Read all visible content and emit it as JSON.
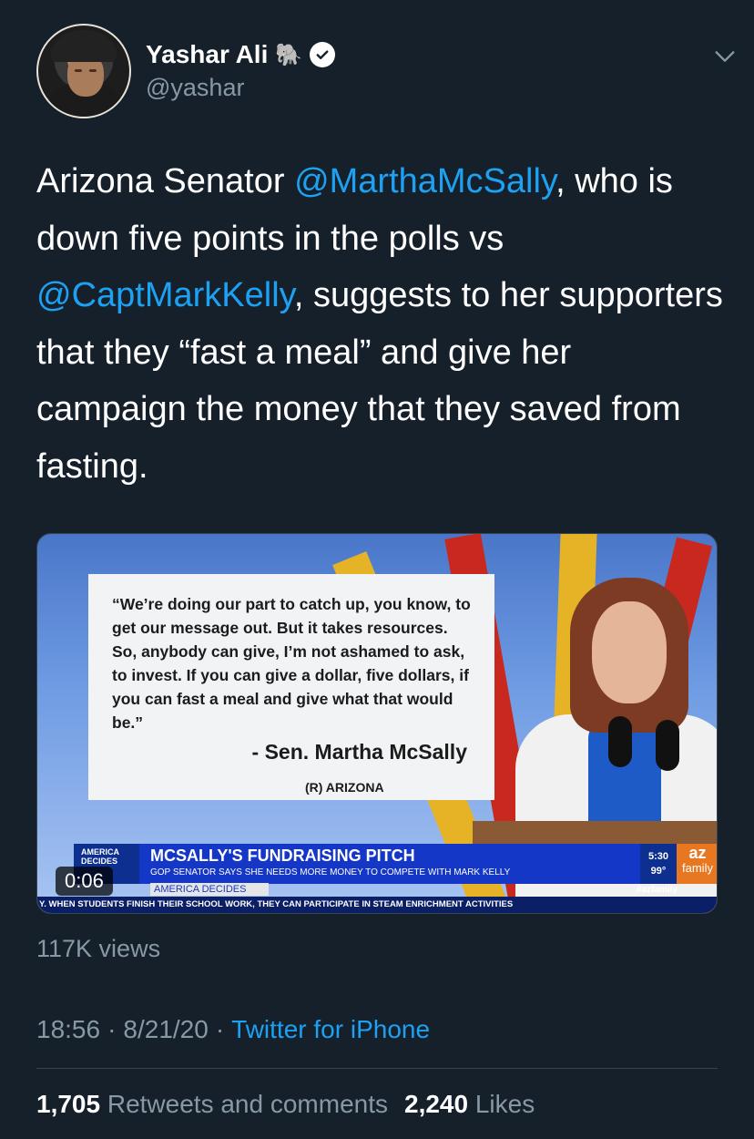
{
  "author": {
    "name": "Yashar Ali",
    "emoji": "🐘",
    "handle": "@yashar"
  },
  "tweet": {
    "part1": "Arizona Senator ",
    "mention1": "@MarthaMcSally",
    "part2": ", who is down five points in the polls vs ",
    "mention2": "@CaptMarkKelly",
    "part3": ", suggests to her supporters that they “fast a meal” and give her campaign the money that they saved from fasting."
  },
  "video": {
    "quote": "“We’re doing our part to catch up, you know, to get our message out. But it takes resources. So, anybody can give, I’m not ashamed to ask, to invest.  If you can give a dollar, five dollars, if you can fast a meal and give what that would be.”",
    "attribution": "- Sen. Martha McSally",
    "attribution_sub": "(R) ARIZONA",
    "logo_text": "AMERICA DECIDES",
    "headline": "MCSALLY'S FUNDRAISING PITCH",
    "subheadline": "GOP SENATOR SAYS SHE NEEDS MORE MONEY TO COMPETE WITH MARK KELLY",
    "time": "5:30",
    "temp": "99°",
    "station_az": "az",
    "station_family": "family",
    "segment": "AMERICA DECIDES",
    "hashtag": "#azfamily",
    "ticker": "Y. WHEN STUDENTS FINISH THEIR SCHOOL WORK, THEY CAN PARTICIPATE IN STEAM ENRICHMENT ACTIVITIES",
    "duration": "0:06"
  },
  "views": "117K views",
  "meta": {
    "time": "18:56",
    "sep1": "·",
    "date": "8/21/20",
    "sep2": "·",
    "source": "Twitter for iPhone"
  },
  "stats": {
    "retweets_count": "1,705",
    "retweets_label": "Retweets and comments",
    "likes_count": "2,240",
    "likes_label": "Likes"
  },
  "colors": {
    "background": "#15202b",
    "accent": "#1da1f2",
    "secondary_text": "#8899a6"
  }
}
